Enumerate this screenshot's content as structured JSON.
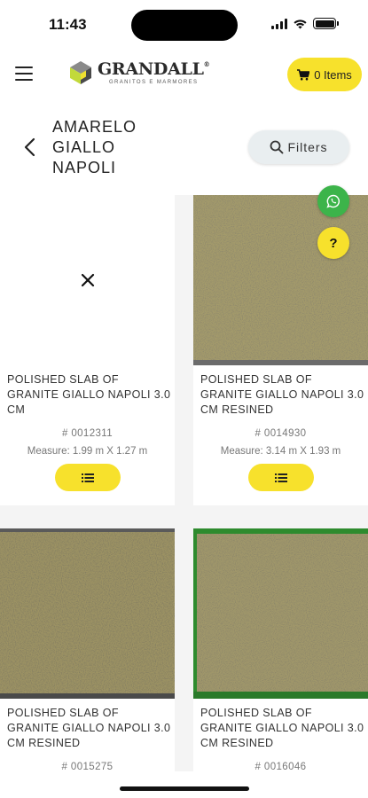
{
  "status_bar": {
    "time": "11:43"
  },
  "header": {
    "brand_name": "GRANDALL",
    "brand_tagline": "GRANITOS E MARMORES",
    "cart_label": "0 Items"
  },
  "title": {
    "lines": [
      "AMARELO",
      "GIALLO",
      "NAPOLI"
    ]
  },
  "filters": {
    "label": "Filters"
  },
  "products": [
    {
      "name": "POLISHED SLAB OF GRANITE GIALLO NAPOLI 3.0 CM",
      "code": "# 0012311",
      "measure": "Measure: 1.99 m X 1.27 m",
      "image": "missing-image"
    },
    {
      "name": "POLISHED SLAB OF GRANITE GIALLO NAPOLI 3.0 CM RESINED",
      "code": "# 0014930",
      "measure": "Measure: 3.14 m X 1.93 m",
      "image": "granite-slab"
    },
    {
      "name": "POLISHED SLAB OF GRANITE GIALLO NAPOLI 3.0 CM RESINED",
      "code": "# 0015275",
      "measure": "",
      "image": "granite-slab"
    },
    {
      "name": "POLISHED SLAB OF GRANITE GIALLO NAPOLI 3.0 CM RESINED",
      "code": "# 0016046",
      "measure": "",
      "image": "granite-slab-on-green"
    }
  ],
  "icons": {
    "menu": "menu-icon",
    "cart": "cart-icon",
    "back": "back-icon",
    "search": "search-icon",
    "whatsapp": "whatsapp-icon",
    "help": "help-icon",
    "list": "list-icon",
    "close": "close-icon"
  },
  "colors": {
    "accent_yellow": "#f7e12c",
    "whatsapp_green": "#3cb44a",
    "filters_bg": "#e9eef0",
    "granite_base": "#a39a6b"
  },
  "help_fab_label": "?"
}
